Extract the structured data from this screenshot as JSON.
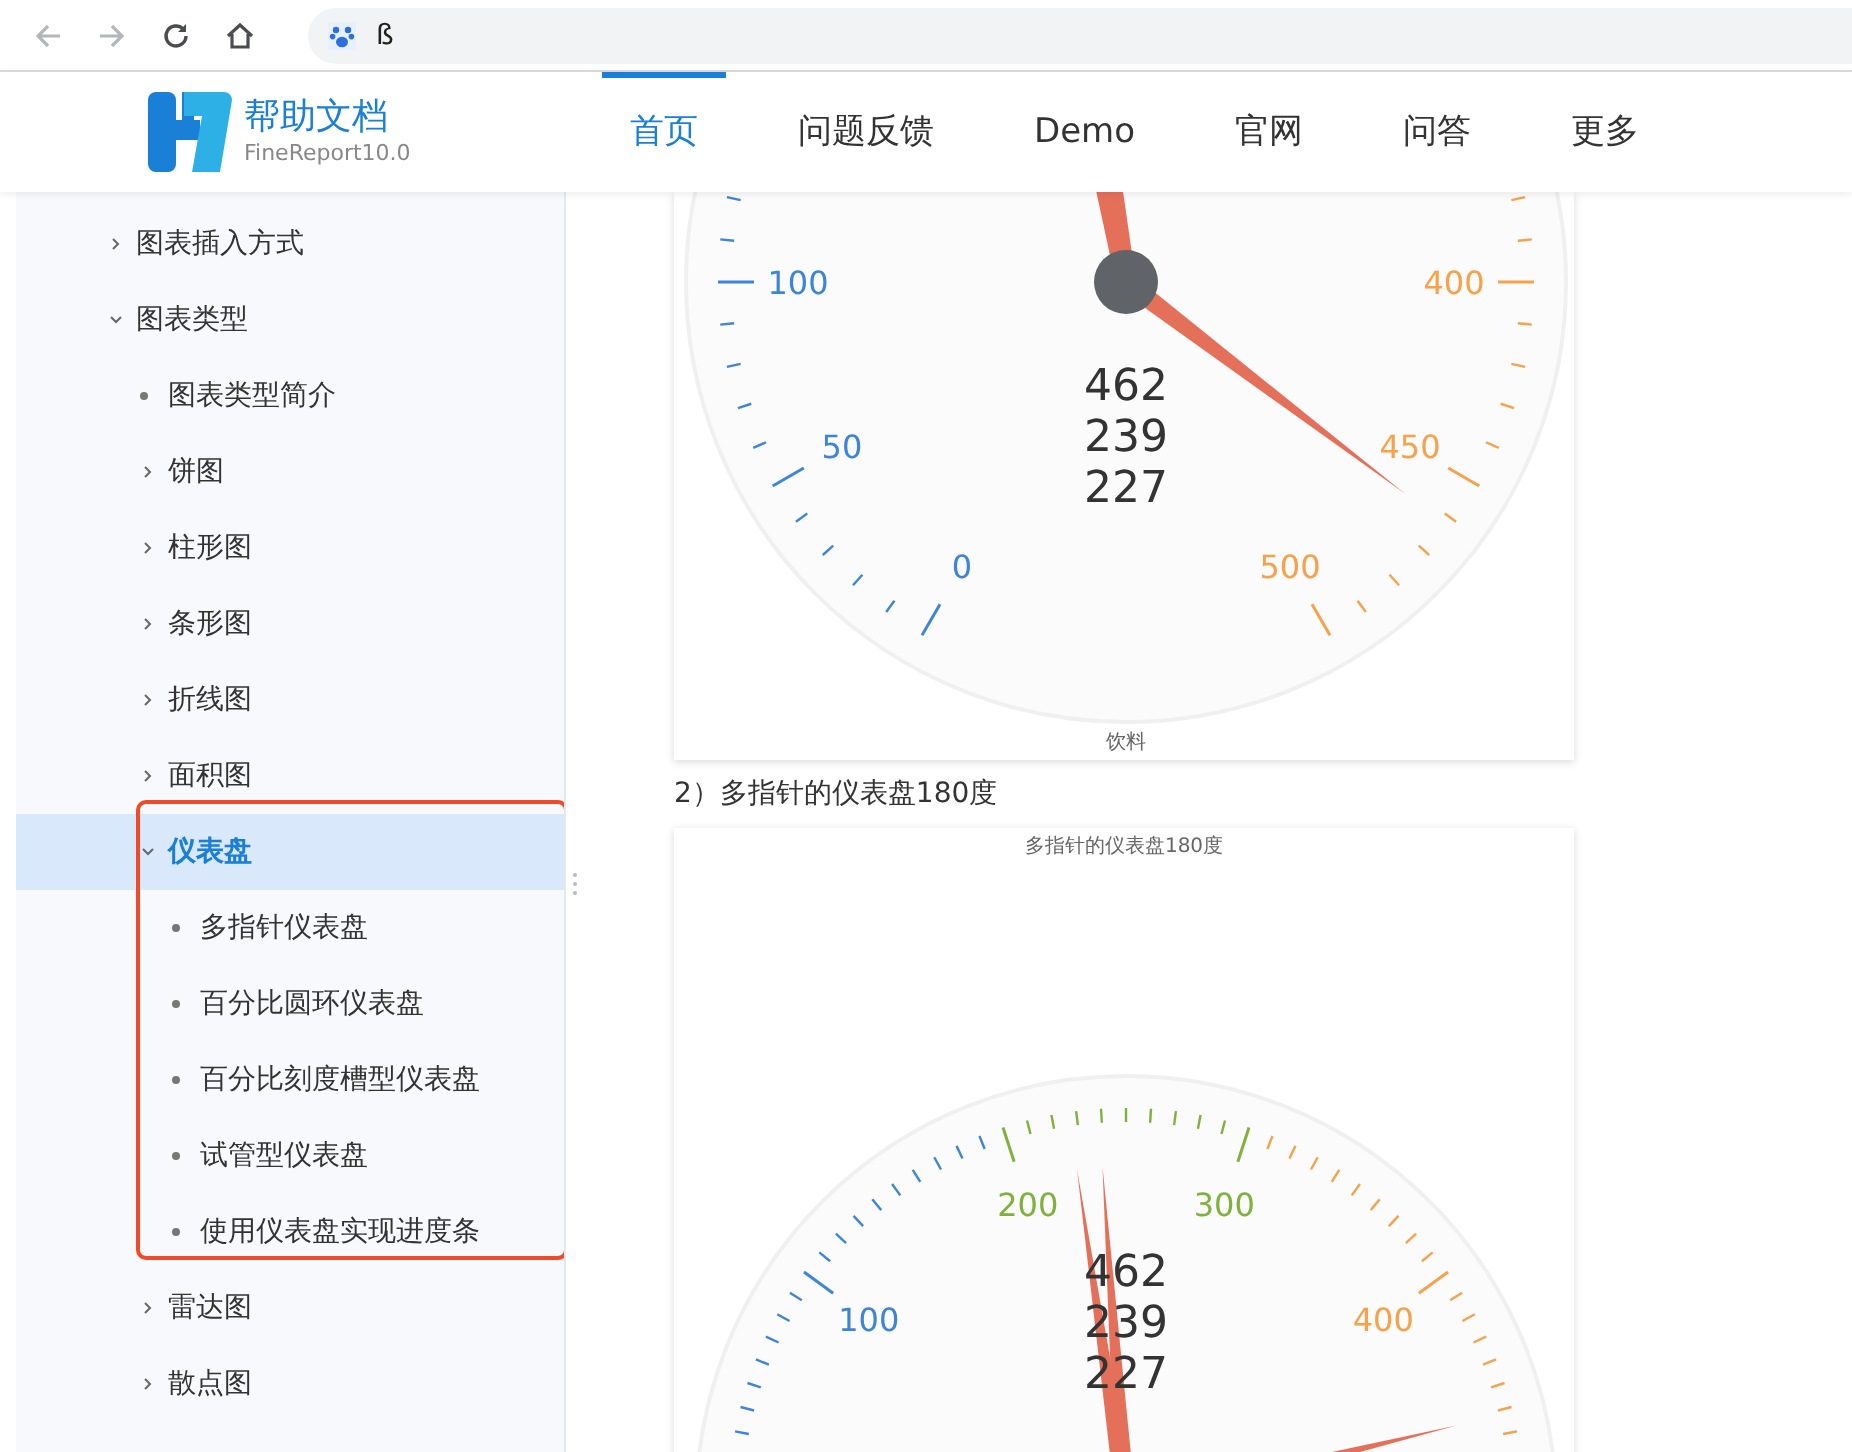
{
  "browser": {
    "buttons": [
      {
        "kind": "back",
        "disabled": true
      },
      {
        "kind": "forward",
        "disabled": true
      },
      {
        "kind": "reload",
        "disabled": false
      },
      {
        "kind": "home",
        "disabled": false
      }
    ],
    "address": "ß"
  },
  "header": {
    "logo_title": "帮助文档",
    "logo_subtitle": "FineReport10.0",
    "nav": [
      {
        "label": "首页",
        "selected": true
      },
      {
        "label": "问题反馈",
        "selected": false
      },
      {
        "label": "Demo",
        "selected": false
      },
      {
        "label": "官网",
        "selected": false
      },
      {
        "label": "问答",
        "selected": false
      },
      {
        "label": "更多",
        "selected": false
      }
    ]
  },
  "sidebar": {
    "items": [
      {
        "label": "图表插入方式",
        "kind": "folder",
        "expanded": false,
        "selected": false,
        "highlighted": false
      },
      {
        "label": "图表类型",
        "kind": "folder",
        "expanded": true,
        "selected": false,
        "highlighted": false,
        "children": [
          {
            "label": "图表类型简介",
            "kind": "leaf",
            "selected": false,
            "highlighted": false
          },
          {
            "label": "饼图",
            "kind": "folder",
            "expanded": false,
            "selected": false,
            "highlighted": false
          },
          {
            "label": "柱形图",
            "kind": "folder",
            "expanded": false,
            "selected": false,
            "highlighted": false
          },
          {
            "label": "条形图",
            "kind": "folder",
            "expanded": false,
            "selected": false,
            "highlighted": false
          },
          {
            "label": "折线图",
            "kind": "folder",
            "expanded": false,
            "selected": false,
            "highlighted": false
          },
          {
            "label": "面积图",
            "kind": "folder",
            "expanded": false,
            "selected": false,
            "highlighted": false
          },
          {
            "label": "仪表盘",
            "kind": "folder",
            "expanded": true,
            "selected": true,
            "highlighted": true,
            "children": [
              {
                "label": "多指针仪表盘",
                "kind": "leaf",
                "selected": false,
                "highlighted": false
              },
              {
                "label": "百分比圆环仪表盘",
                "kind": "leaf",
                "selected": false,
                "highlighted": false
              },
              {
                "label": "百分比刻度槽型仪表盘",
                "kind": "leaf",
                "selected": false,
                "highlighted": false
              },
              {
                "label": "试管型仪表盘",
                "kind": "leaf",
                "selected": false,
                "highlighted": false
              },
              {
                "label": "使用仪表盘实现进度条",
                "kind": "leaf",
                "selected": false,
                "highlighted": false
              }
            ]
          },
          {
            "label": "雷达图",
            "kind": "folder",
            "expanded": false,
            "selected": false,
            "highlighted": false
          },
          {
            "label": "散点图",
            "kind": "folder",
            "expanded": false,
            "selected": false,
            "highlighted": false
          }
        ]
      }
    ]
  },
  "content": {
    "blocks": [
      {
        "kind": "gauge270",
        "tick_labels": [
          "0",
          "50",
          "100",
          "400",
          "450",
          "500"
        ],
        "values": [
          "462",
          "239",
          "227"
        ],
        "footer": "饮料"
      },
      {
        "kind": "heading",
        "text": "2）多指针的仪表盘180度"
      },
      {
        "kind": "gauge180",
        "title": "多指针的仪表盘180度",
        "tick_labels": [
          "100",
          "200",
          "300",
          "400"
        ],
        "values": [
          "462",
          "239",
          "227"
        ]
      }
    ]
  }
}
